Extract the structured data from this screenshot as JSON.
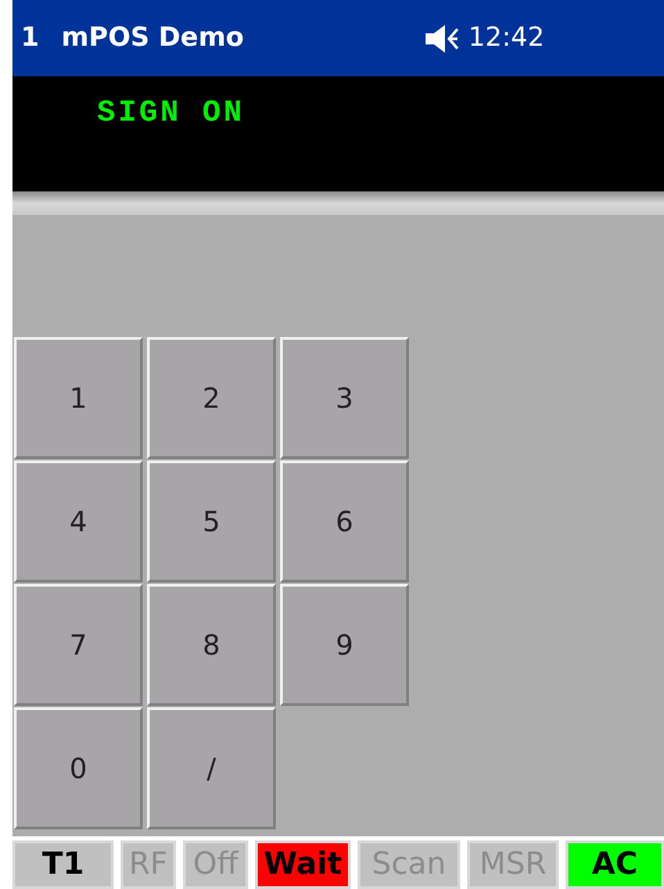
{
  "title_bar": {
    "number": "1",
    "title": "mPOS Demo",
    "time": "12:42"
  },
  "display": {
    "line_1": "SIGN ON"
  },
  "keypad": [
    "1",
    "2",
    "3",
    "4",
    "5",
    "6",
    "7",
    "8",
    "9",
    "0",
    "/"
  ],
  "status_bar": [
    {
      "label": "T1",
      "disabled": false,
      "color": "#c0c0c0"
    },
    {
      "label": "RF",
      "disabled": true,
      "color": "#c0c0c0"
    },
    {
      "label": "Off",
      "disabled": true,
      "color": "#c0c0c0"
    },
    {
      "label": "Wait",
      "disabled": false,
      "color": "#ff0000"
    },
    {
      "label": "Scan",
      "disabled": true,
      "color": "#c0c0c0"
    },
    {
      "label": "MSR",
      "disabled": true,
      "color": "#c0c0c0"
    },
    {
      "label": "AC",
      "disabled": false,
      "color": "#00ff00"
    }
  ]
}
